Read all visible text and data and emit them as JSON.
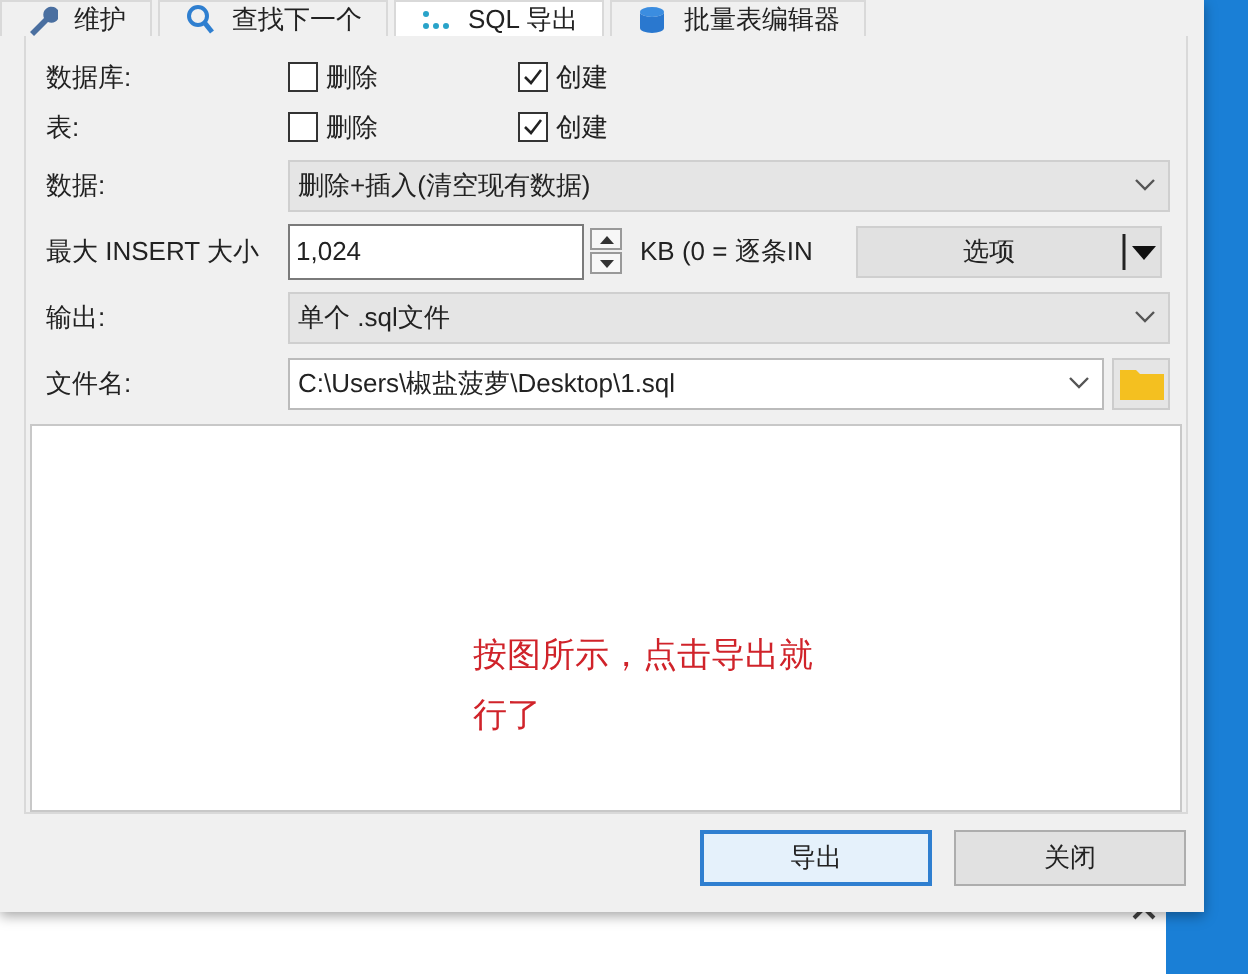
{
  "tabs": [
    {
      "label": "维护",
      "selected": false
    },
    {
      "label": "查找下一个",
      "selected": false
    },
    {
      "label": "SQL 导出",
      "selected": true
    },
    {
      "label": "批量表编辑器",
      "selected": false
    }
  ],
  "form": [
    {
      "kind": "checks",
      "label": "数据库:",
      "options": [
        {
          "label": "删除",
          "checked": false
        },
        {
          "label": "创建",
          "checked": true
        }
      ]
    },
    {
      "kind": "checks",
      "label": "表:",
      "options": [
        {
          "label": "删除",
          "checked": false
        },
        {
          "label": "创建",
          "checked": true
        }
      ]
    },
    {
      "kind": "dropdown",
      "label": "数据:",
      "value": "删除+插入(清空现有数据)"
    },
    {
      "kind": "spin",
      "label": "最大 INSERT 大小",
      "value": "1,024",
      "unit": "KB (0 = 逐条IN",
      "button": "选项"
    },
    {
      "kind": "dropdown",
      "label": "输出:",
      "value": "单个 .sql文件"
    },
    {
      "kind": "combo",
      "label": "文件名:",
      "value": "C:\\Users\\椒盐菠萝\\Desktop\\1.sql"
    }
  ],
  "log": {
    "text": "按图所示，点击导出就行了"
  },
  "buttons": [
    {
      "label": "导出",
      "selected": true
    },
    {
      "label": "关闭",
      "selected": false
    }
  ]
}
